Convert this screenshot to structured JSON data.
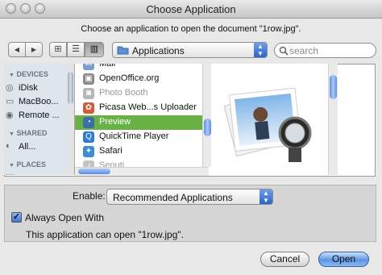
{
  "window": {
    "title": "Choose Application"
  },
  "prompt": "Choose an application to open the document \"1row.jpg\".",
  "toolbar": {
    "back": "◀",
    "forward": "▶",
    "view_icon": "⊞",
    "view_list": "☰",
    "view_column": "▥",
    "location": "Applications",
    "search_placeholder": "search"
  },
  "sidebar": {
    "devices_heading": "DEVICES",
    "devices": [
      {
        "label": "iDisk",
        "icon": "globe-icon"
      },
      {
        "label": "MacBoo...",
        "icon": "laptop-icon"
      },
      {
        "label": "Remote ...",
        "icon": "disc-icon"
      }
    ],
    "shared_heading": "SHARED",
    "shared": [
      {
        "label": "All...",
        "icon": "network-icon"
      }
    ],
    "places_heading": "PLACES"
  },
  "apps": [
    {
      "label": "Mail",
      "dim": false,
      "selected": false,
      "color": "#7b9bd1",
      "icon": "mail-icon"
    },
    {
      "label": "OpenOffice.org",
      "dim": false,
      "selected": false,
      "color": "#8a8a8a",
      "icon": "folder-icon"
    },
    {
      "label": "Photo Booth",
      "dim": true,
      "selected": false,
      "color": "#b8b8b8",
      "icon": "camera-icon"
    },
    {
      "label": "Picasa Web...s Uploader",
      "dim": false,
      "selected": false,
      "color": "#d05a3a",
      "icon": "picasa-icon"
    },
    {
      "label": "Preview",
      "dim": false,
      "selected": true,
      "color": "#3b6ea6",
      "icon": "preview-icon"
    },
    {
      "label": "QuickTime Player",
      "dim": false,
      "selected": false,
      "color": "#2c7bd6",
      "icon": "quicktime-icon"
    },
    {
      "label": "Safari",
      "dim": false,
      "selected": false,
      "color": "#3a8ed8",
      "icon": "compass-icon"
    },
    {
      "label": "Senuti",
      "dim": true,
      "selected": false,
      "color": "#c4c4c4",
      "icon": "music-icon"
    }
  ],
  "enable": {
    "label": "Enable:",
    "value": "Recommended Applications"
  },
  "always_open": {
    "label": "Always Open With",
    "checked": true
  },
  "note": "This application can open \"1row.jpg\".",
  "buttons": {
    "cancel": "Cancel",
    "open": "Open"
  },
  "colors": {
    "selection": "#68b245",
    "accent": "#3a72d4"
  }
}
